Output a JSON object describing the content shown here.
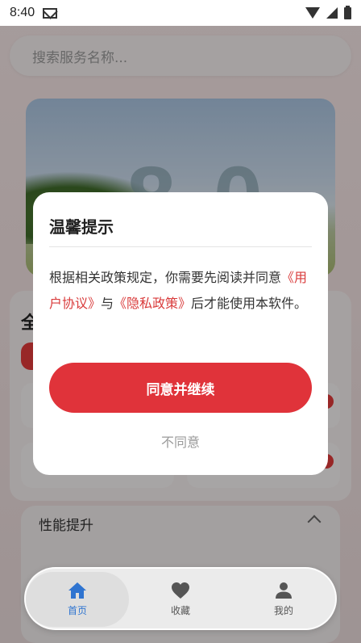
{
  "status_bar": {
    "time": "8:40"
  },
  "search": {
    "placeholder": "搜索服务名称..."
  },
  "banner": {
    "number_text": "8.0"
  },
  "section": {
    "title_partial": "全"
  },
  "performance": {
    "title": "性能提升"
  },
  "modal": {
    "title": "温馨提示",
    "body_prefix": "根据相关政策规定，你需要先阅读并同意",
    "user_agreement_link": "《用户协议》",
    "body_and": "与",
    "privacy_policy_link": "《隐私政策》",
    "body_suffix": "后才能使用本软件。",
    "agree_label": "同意并继续",
    "disagree_label": "不同意"
  },
  "tabbar": {
    "tabs": [
      {
        "label": "首页",
        "icon": "home-icon",
        "active": true
      },
      {
        "label": "收藏",
        "icon": "heart-icon",
        "active": false
      },
      {
        "label": "我的",
        "icon": "person-icon",
        "active": false
      }
    ]
  },
  "colors": {
    "accent_red": "#e0333a",
    "link_red": "#d93b3b",
    "tab_active_blue": "#2f74d0"
  }
}
